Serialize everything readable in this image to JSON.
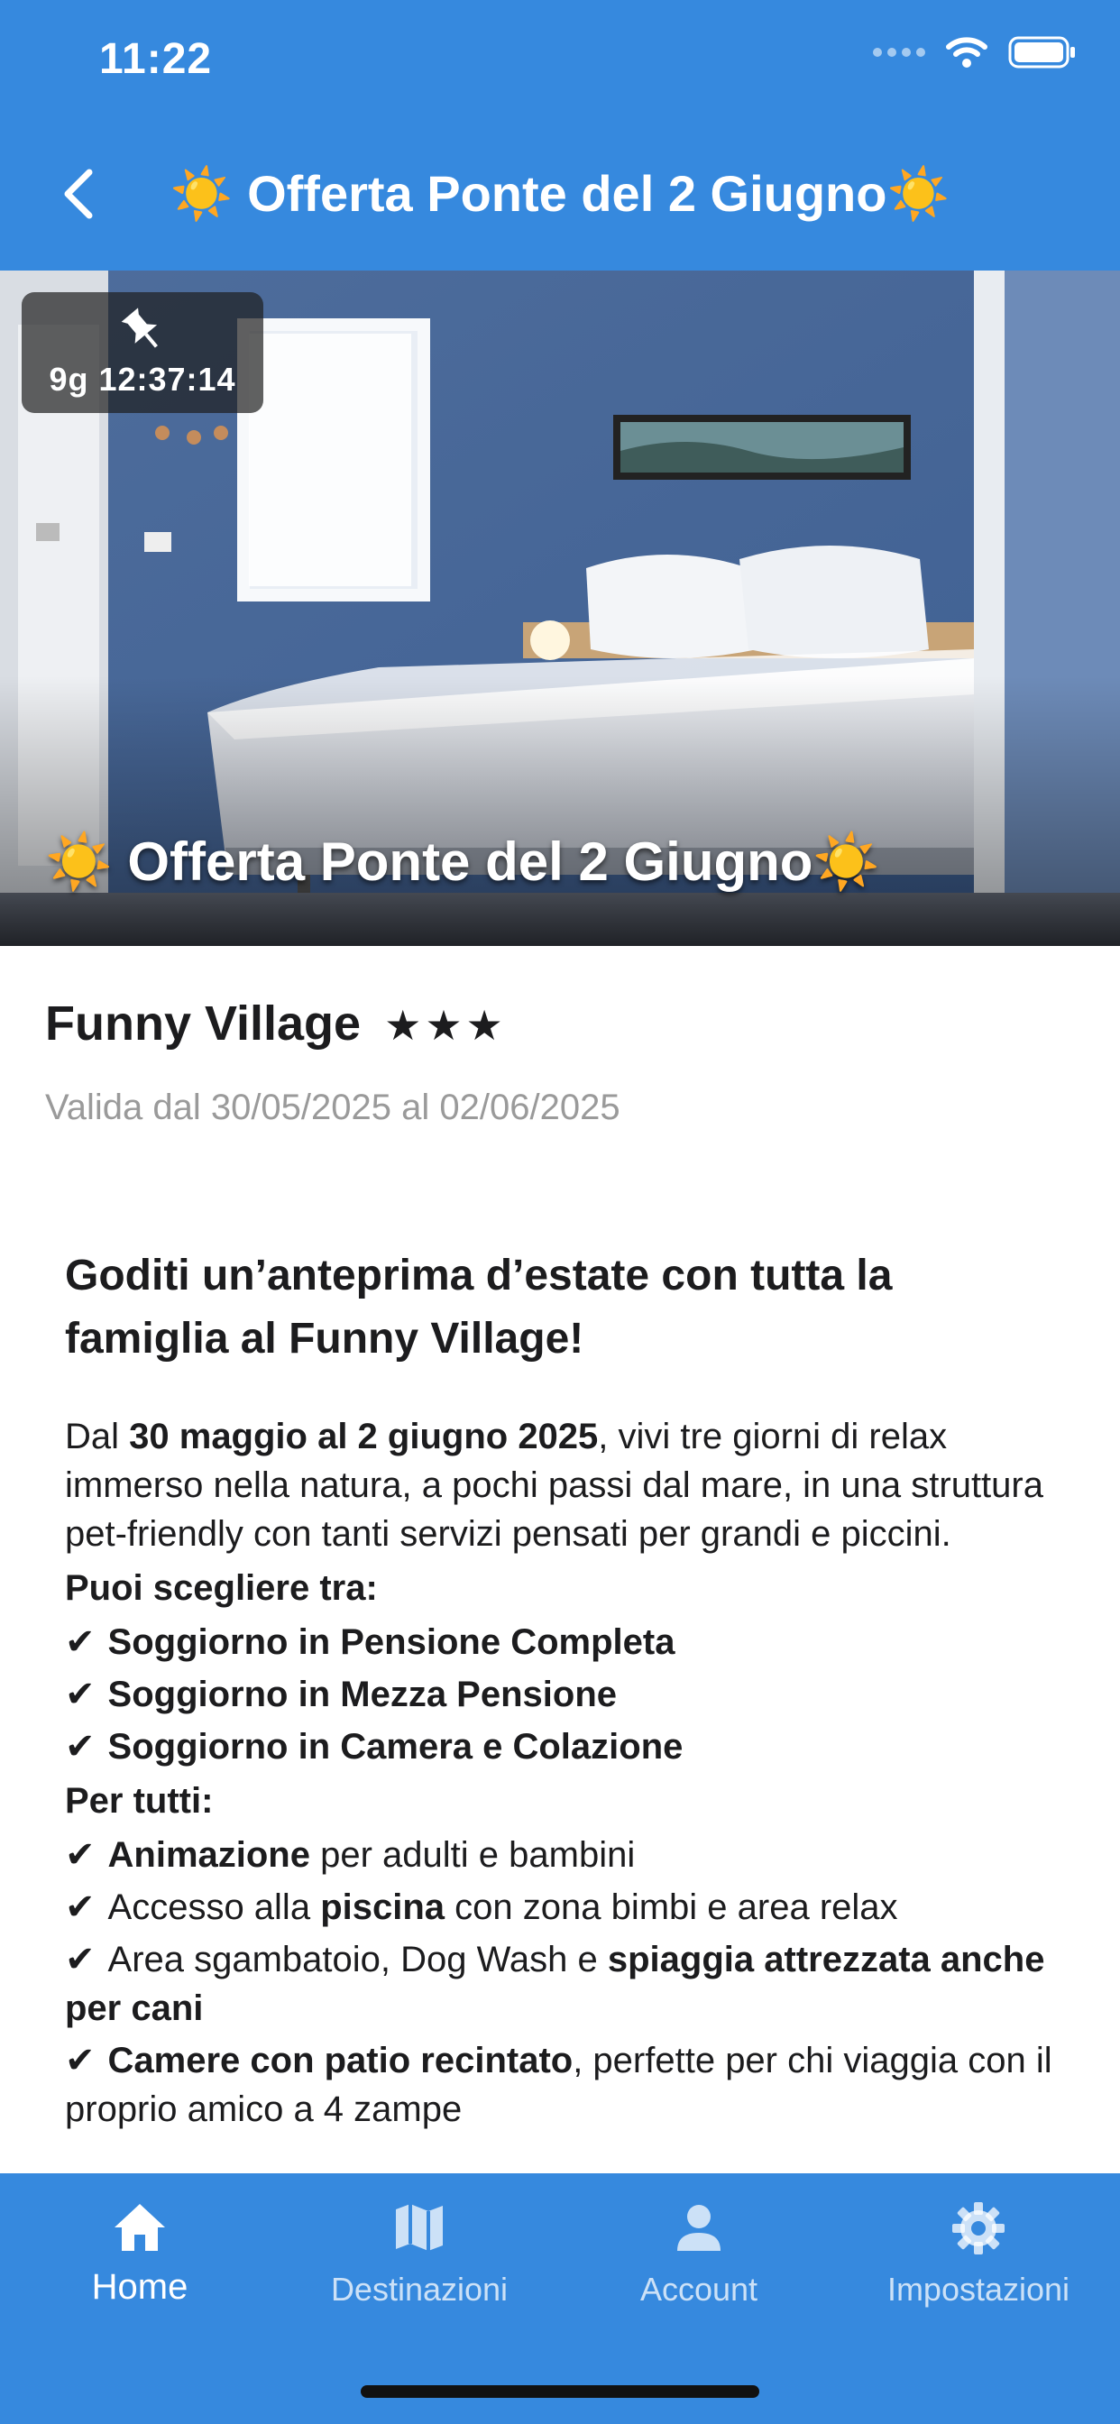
{
  "status_bar": {
    "time": "11:22"
  },
  "header": {
    "title": "☀️ Offerta Ponte del 2 Giugno☀️"
  },
  "hero": {
    "countdown": "9g 12:37:14",
    "caption": "☀️ Offerta Ponte del 2 Giugno☀️"
  },
  "hotel": {
    "name": "Funny Village",
    "stars": "★★★",
    "validity": "Valida dal 30/05/2025 al 02/06/2025"
  },
  "description": {
    "headline": "Goditi un’anteprima d’estate con tutta la famiglia al Funny Village!",
    "intro_prefix": "Dal ",
    "intro_bold": "30 maggio al 2 giugno 2025",
    "intro_rest": ", vivi tre giorni di relax immerso nella natura, a pochi passi dal mare, in una struttura pet-friendly con tanti servizi pensati per grandi e piccini.",
    "choose_label": "Puoi scegliere tra:",
    "options": [
      "Soggiorno in Pensione Completa",
      "Soggiorno in Mezza Pensione",
      "Soggiorno in Camera e Colazione"
    ],
    "for_all_label": "Per tutti:",
    "check_mark": "✔",
    "feature_1_bold": "Animazione",
    "feature_1_rest": " per adulti e bambini",
    "feature_2_prefix": "Accesso alla ",
    "feature_2_bold": "piscina",
    "feature_2_rest": " con zona bimbi e area relax",
    "feature_3_prefix": "Area sgambatoio, Dog Wash e ",
    "feature_3_bold": "spiaggia attrezzata anche per cani",
    "feature_4_bold": "Camere con patio recintato",
    "feature_4_rest": ", perfette per chi viaggia con il proprio amico a 4 zampe"
  },
  "tabs": [
    {
      "label": "Home",
      "icon": "home-icon",
      "active": true
    },
    {
      "label": "Destinazioni",
      "icon": "map-icon",
      "active": false
    },
    {
      "label": "Account",
      "icon": "person-icon",
      "active": false
    },
    {
      "label": "Impostazioni",
      "icon": "gear-icon",
      "active": false
    }
  ],
  "colors": {
    "primary": "#3689de",
    "text": "#1c1c1e",
    "muted": "#9a9a9a"
  }
}
